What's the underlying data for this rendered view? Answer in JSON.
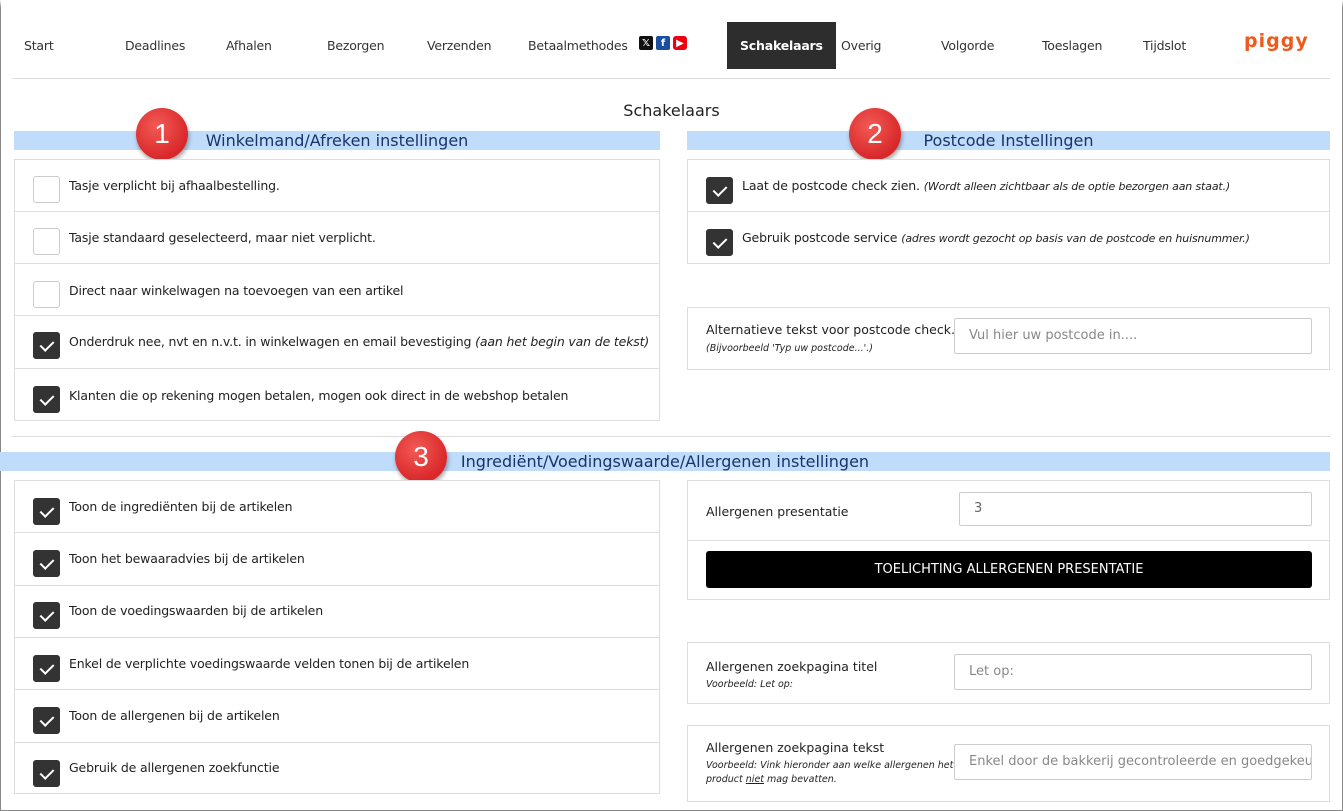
{
  "nav": {
    "items": [
      "Start",
      "Deadlines",
      "Afhalen",
      "Bezorgen",
      "Verzenden",
      "Betaalmethodes",
      "Schakelaars",
      "Overig",
      "Volgorde",
      "Toeslagen",
      "Tijdslot"
    ],
    "active": "Schakelaars",
    "social": [
      "x-icon",
      "facebook-icon",
      "youtube-icon"
    ],
    "logo": "piggy"
  },
  "colors": {
    "section_bg": "#bfdcfa",
    "section_text": "#19336b",
    "logo": "#ef5a1c",
    "badge": "#d9272a",
    "active_nav": "#2d2d2d"
  },
  "page_title": "Schakelaars",
  "badges": [
    "1",
    "2",
    "3"
  ],
  "cart": {
    "title": "Winkelmand/Afreken instellingen",
    "rows": [
      {
        "label": "Tasje verplicht bij afhaalbestelling.",
        "note": "",
        "checked": false
      },
      {
        "label": "Tasje standaard geselecteerd, maar niet verplicht.",
        "note": "",
        "checked": false
      },
      {
        "label": "Direct naar winkelwagen na toevoegen van een artikel",
        "note": "",
        "checked": false
      },
      {
        "label": "Onderdruk nee, nvt en n.v.t. in winkelwagen en email bevestiging",
        "note": "(aan het begin van de tekst)",
        "checked": true
      },
      {
        "label": "Klanten die op rekening mogen betalen, mogen ook direct in de webshop betalen",
        "note": "",
        "checked": true
      }
    ]
  },
  "postcode": {
    "title": "Postcode Instellingen",
    "rows": [
      {
        "label": "Laat de postcode check zien.",
        "note": "(Wordt alleen zichtbaar als de optie bezorgen aan staat.)",
        "checked": true
      },
      {
        "label": "Gebruik postcode service",
        "note": "(adres wordt gezocht op basis van de postcode en huisnummer.)",
        "checked": true
      }
    ],
    "alt_text": {
      "label": "Alternatieve tekst voor postcode check.",
      "sub": "(Bijvoorbeeld 'Typ uw postcode...'.)",
      "placeholder": "Vul hier uw postcode in...."
    }
  },
  "ingredients": {
    "title": "Ingrediënt/Voedingswaarde/Allergenen instellingen",
    "rows": [
      {
        "label": "Toon de ingrediënten bij de artikelen",
        "checked": true
      },
      {
        "label": "Toon het bewaaradvies bij de artikelen",
        "checked": true
      },
      {
        "label": "Toon de voedingswaarden bij de artikelen",
        "checked": true
      },
      {
        "label": "Enkel de verplichte voedingswaarde velden tonen bij de artikelen",
        "checked": true
      },
      {
        "label": "Toon de allergenen bij de artikelen",
        "checked": true
      },
      {
        "label": "Gebruik de allergenen zoekfunctie",
        "checked": true
      }
    ],
    "presentation": {
      "label": "Allergenen presentatie",
      "value": "3",
      "button": "TOELICHTING ALLERGENEN PRESENTATIE"
    },
    "search_title": {
      "label": "Allergenen zoekpagina titel",
      "sub": "Voorbeeld: Let op:",
      "placeholder": "Let op:"
    },
    "search_text": {
      "label": "Allergenen zoekpagina tekst",
      "sub_a": "Voorbeeld: Vink hieronder aan welke allergenen het",
      "sub_b1": "product ",
      "sub_b2": "niet",
      "sub_b3": " mag bevatten.",
      "placeholder": "Enkel door de bakkerij gecontroleerde en goedgekeurde"
    }
  }
}
